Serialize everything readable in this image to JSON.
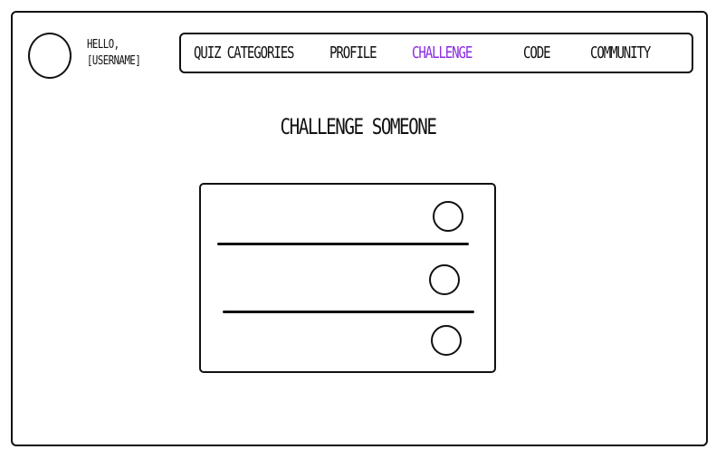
{
  "header": {
    "greeting_line1": "HELLO,",
    "greeting_line2": "[USERNAME]"
  },
  "nav": {
    "items": [
      {
        "label": "QUIZ CATEGORIES",
        "active": false
      },
      {
        "label": "PROFILE",
        "active": false
      },
      {
        "label": "CHALLENGE",
        "active": true
      },
      {
        "label": "CODE",
        "active": false
      },
      {
        "label": "COMMUNITY",
        "active": false
      }
    ],
    "active_color": "#8b2be2"
  },
  "main": {
    "title": "CHALLENGE SOMEONE",
    "options": [
      {
        "selected": false
      },
      {
        "selected": false
      },
      {
        "selected": false
      }
    ]
  }
}
